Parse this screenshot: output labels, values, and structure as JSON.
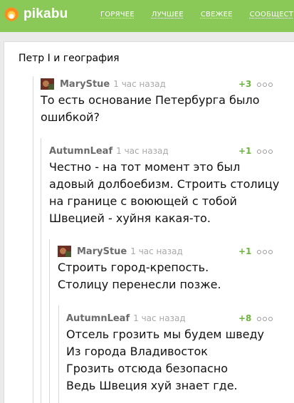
{
  "header": {
    "logo_text": "pikabu",
    "nav": [
      "ГОРЯЧЕЕ",
      "ЛУЧШЕЕ",
      "СВЕЖЕЕ",
      "СООБЩЕСТ"
    ]
  },
  "post": {
    "title": "Петр I и география"
  },
  "comments": [
    {
      "author": "MaryStue",
      "time": "1 час назад",
      "rating": "+3",
      "text": "То есть основание Петербурга было\nошибкой?"
    },
    {
      "author": "AutumnLeaf",
      "time": "1 час назад",
      "rating": "+1",
      "text": "Честно - на тот момент это был\nадовый долбоебизм. Строить столицу\nна границе с воюющей с тобой\nШвецией - хуйня какая-то."
    },
    {
      "author": "MaryStue",
      "time": "1 час назад",
      "rating": "+1",
      "text": "Строить город-крепость.\nСтолицу перенесли позже."
    },
    {
      "author": "AutumnLeaf",
      "time": "1 час назад",
      "rating": "+8",
      "text": "Отсель грозить мы будем шведу\nИз города Владивосток\nГрозить отсюда безопасно\nВедь Швеция хуй знает где."
    }
  ],
  "colors": {
    "header_bg": "#8ac858",
    "rating": "#6db33f",
    "author": "#6b6b6b",
    "time": "#a9a9a9"
  }
}
